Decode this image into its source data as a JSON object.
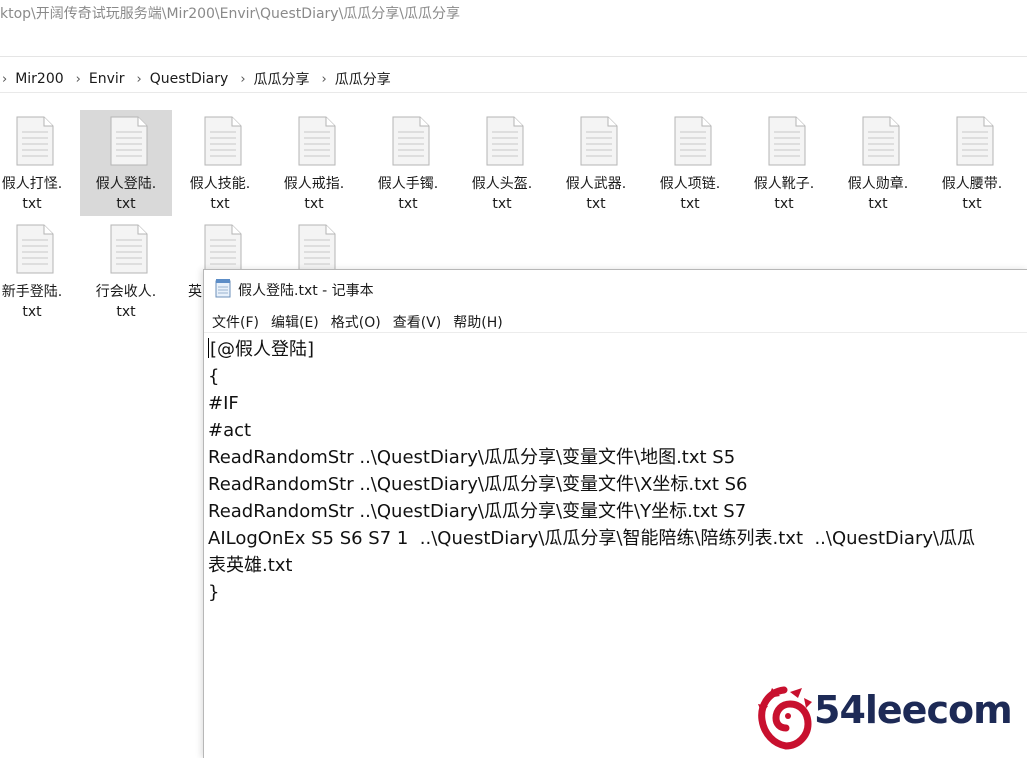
{
  "explorer": {
    "title_path": "ktop\\开阔传奇试玩服务端\\Mir200\\Envir\\QuestDiary\\瓜瓜分享\\瓜瓜分享",
    "breadcrumbs": [
      "Mir200",
      "Envir",
      "QuestDiary",
      "瓜瓜分享",
      "瓜瓜分享"
    ],
    "files_row1": [
      {
        "name1": "假人打怪.",
        "name2": "txt"
      },
      {
        "name1": "假人登陆.",
        "name2": "txt",
        "selected": true
      },
      {
        "name1": "假人技能.",
        "name2": "txt"
      },
      {
        "name1": "假人戒指.",
        "name2": "txt"
      },
      {
        "name1": "假人手镯.",
        "name2": "txt"
      },
      {
        "name1": "假人头盔.",
        "name2": "txt"
      },
      {
        "name1": "假人武器.",
        "name2": "txt"
      },
      {
        "name1": "假人项链.",
        "name2": "txt"
      },
      {
        "name1": "假人靴子.",
        "name2": "txt"
      },
      {
        "name1": "假人勋章.",
        "name2": "txt"
      },
      {
        "name1": "假人腰带.",
        "name2": "txt"
      }
    ],
    "files_row2": [
      {
        "name1": "新手登陆.",
        "name2": "txt"
      },
      {
        "name1": "行会收人.",
        "name2": "txt"
      },
      {
        "name1": "英",
        "name2": ""
      },
      {
        "name1": "",
        "name2": ""
      }
    ]
  },
  "notepad": {
    "title": "假人登陆.txt - 记事本",
    "menu": [
      "文件(F)",
      "编辑(E)",
      "格式(O)",
      "查看(V)",
      "帮助(H)"
    ],
    "lines": [
      "[@假人登陆]",
      "{",
      "#IF",
      "#act",
      "ReadRandomStr ..\\QuestDiary\\瓜瓜分享\\变量文件\\地图.txt S5",
      "ReadRandomStr ..\\QuestDiary\\瓜瓜分享\\变量文件\\X坐标.txt S6",
      "ReadRandomStr ..\\QuestDiary\\瓜瓜分享\\变量文件\\Y坐标.txt S7",
      "AILogOnEx S5 S6 S7 1  ..\\QuestDiary\\瓜瓜分享\\智能陪练\\陪练列表.txt  ..\\QuestDiary\\瓜瓜",
      "表英雄.txt",
      "}"
    ]
  },
  "watermark": {
    "text": "54leecom",
    "colors": {
      "logo": "#c8102e",
      "text": "#1d2a56"
    }
  },
  "colors": {
    "selection": "#d9d9d9",
    "doc_icon_fill": "#f4f4f4",
    "doc_icon_stroke": "#b5b5b5"
  }
}
